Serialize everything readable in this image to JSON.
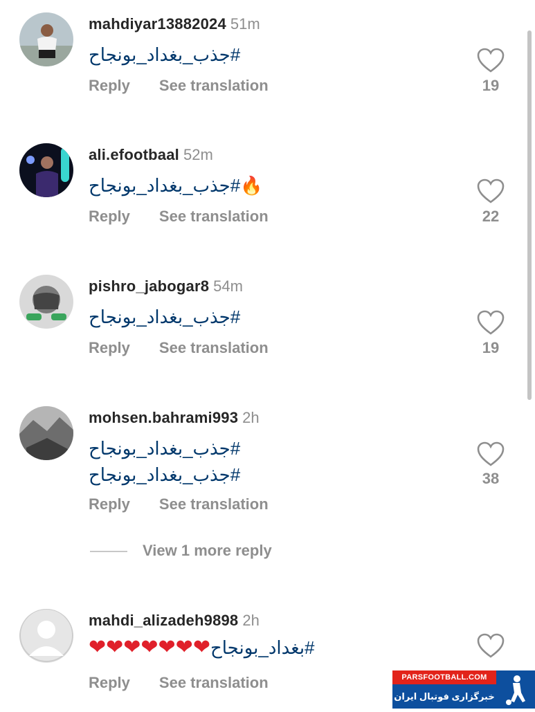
{
  "comments": [
    {
      "username": "mahdiyar13882024",
      "time": "51m",
      "lines": [
        "#جذب_بغداد_بونجاح"
      ],
      "reply_label": "Reply",
      "translate_label": "See translation",
      "likes": "19",
      "avatar": "person-photo"
    },
    {
      "username": "ali.efootbaal",
      "time": "52m",
      "lines": [
        "🔥#جذب_بغداد_بونجاح"
      ],
      "reply_label": "Reply",
      "translate_label": "See translation",
      "likes": "22",
      "avatar": "efootball-photo"
    },
    {
      "username": "pishro_jabogar8",
      "time": "54m",
      "lines": [
        "#جذب_بغداد_بونجاح"
      ],
      "reply_label": "Reply",
      "translate_label": "See translation",
      "likes": "19",
      "avatar": "covered-face-photo"
    },
    {
      "username": "mohsen.bahrami993",
      "time": "2h",
      "lines": [
        "#جذب_بغداد_بونجاح",
        "#جذب_بغداد_بونجاح"
      ],
      "reply_label": "Reply",
      "translate_label": "See translation",
      "likes": "38",
      "avatar": "landscape-photo"
    },
    {
      "username": "mahdi_alizadeh9898",
      "time": "2h",
      "lines": [
        "#بغداد_بونجاح"
      ],
      "hearts": "❤❤❤❤❤❤❤",
      "reply_label": "Reply",
      "translate_label": "See translation",
      "likes": "",
      "avatar": "default-avatar"
    }
  ],
  "view_more_replies": "View 1 more reply",
  "watermark": {
    "top": "PARSFOOTBALL.COM",
    "bottom": "خبرگزاری فوتبال ایران"
  },
  "colors": {
    "hashtag": "#00376b",
    "muted": "#8e8e8e",
    "heart": "#e0202a",
    "watermark_red": "#e2231a",
    "watermark_blue": "#0d4f9e"
  }
}
